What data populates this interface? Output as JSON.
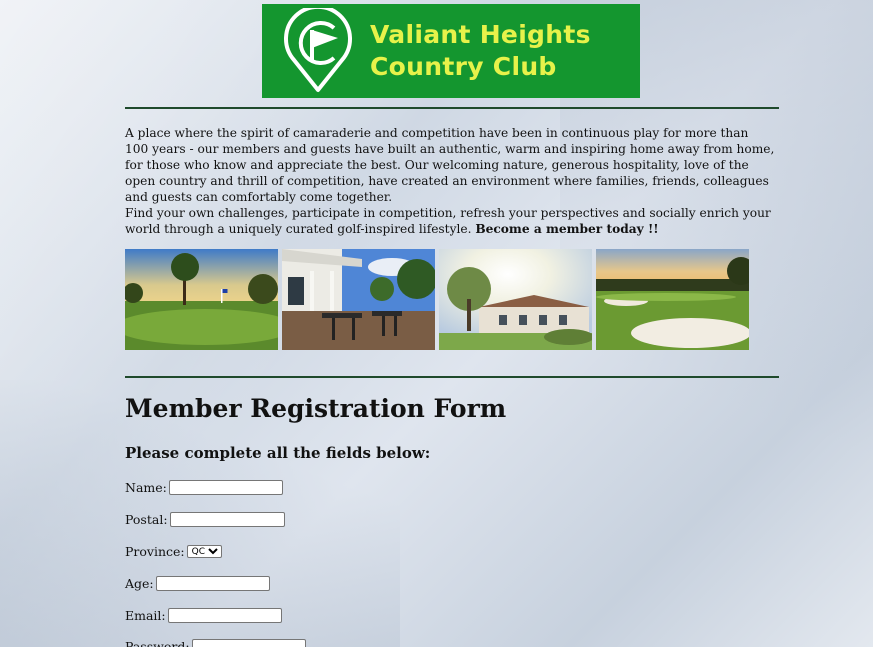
{
  "logo": {
    "line1": "Valiant Heights",
    "line2": "Country Club",
    "bg_color": "#14962f",
    "text_color": "#e7f24a"
  },
  "intro": {
    "paragraph1": "A place where the spirit of camaraderie and competition have been in continuous play for more than 100 years - our members and guests have built an authentic, warm and inspiring home away from home, for those who know and appreciate the best. Our welcoming nature, generous hospitality, love of the open country and thrill of competition, have created an environment where families, friends, colleagues and guests can comfortably come together.",
    "paragraph2": "Find your own challenges, participate in competition, refresh your perspectives and socially enrich your world through a uniquely curated golf-inspired lifestyle.",
    "cta": "Become a member today !!"
  },
  "gallery": {
    "photos": [
      "golf-course-green",
      "clubhouse-patio",
      "clubhouse-exterior",
      "sand-bunker-sunset"
    ]
  },
  "form": {
    "title": "Member Registration Form",
    "subtitle": "Please complete all the fields below:",
    "fields": {
      "name_label": "Name:",
      "postal_label": "Postal:",
      "province_label": "Province:",
      "province_value": "QC",
      "age_label": "Age:",
      "email_label": "Email:",
      "password_label": "Password:"
    }
  }
}
